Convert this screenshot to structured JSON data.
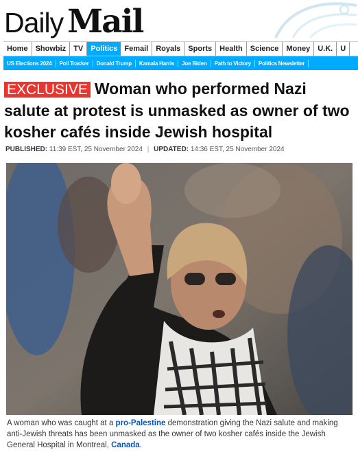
{
  "brand": {
    "logo_daily": "Daily",
    "logo_mail": "Mail"
  },
  "nav": {
    "items": [
      "Home",
      "Showbiz",
      "TV",
      "Politics",
      "Femail",
      "Royals",
      "Sports",
      "Health",
      "Science",
      "Money",
      "U.K.",
      "U"
    ],
    "active": "Politics",
    "colors": {
      "active_bg": "#00aaff",
      "active_text": "#ffffff"
    }
  },
  "subnav": {
    "items": [
      "US Elections 2024",
      "Poll Tracker",
      "Donald Trump",
      "Kamala Harris",
      "Joe Biden",
      "Path to Victory",
      "Politics Newsletter"
    ],
    "color": "#00aaff"
  },
  "article": {
    "badge": "EXCLUSIVE",
    "badge_color": "#e8352f",
    "headline": "Woman who performed Nazi salute at protest is unmasked as owner of two kosher cafés inside Jewish hospital",
    "published_label": "PUBLISHED:",
    "published": "11:39 EST, 25 November 2024",
    "updated_label": "UPDATED:",
    "updated": "14:36 EST, 25 November 2024",
    "caption": {
      "part1": "A woman who was caught at a ",
      "link1": "pro-Palestine",
      "part2": " demonstration giving the Nazi salute and making anti-Jewish threats has been unmasked as the owner of two kosher cafés inside the Jewish General Hospital in Montreal, ",
      "link2": "Canada",
      "part3": "."
    }
  }
}
